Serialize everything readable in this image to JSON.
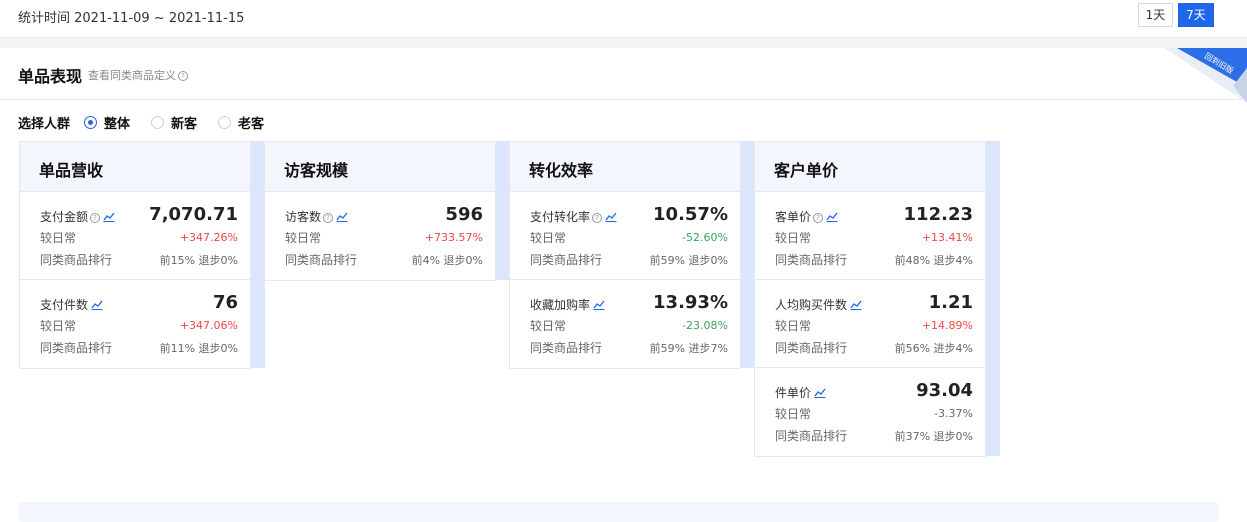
{
  "header": {
    "period_label": "统计时间 2021-11-09 ~ 2021-11-15",
    "range_options": [
      "1天",
      "7天"
    ],
    "active_range": "7天"
  },
  "section": {
    "title": "单品表现",
    "definition_link": "查看同类商品定义",
    "ribbon_text": "回到旧版"
  },
  "audience": {
    "label": "选择人群",
    "options": [
      "整体",
      "新客",
      "老客"
    ],
    "selected": "整体"
  },
  "colors": {
    "accent": "#1f66e8",
    "increase": "#f04646",
    "decrease": "#3aa55a",
    "card_header": "#f3f6fd"
  },
  "cards": [
    {
      "title": "单品营收",
      "metrics": [
        {
          "name": "支付金额",
          "help_icon": true,
          "value": "7,070.71",
          "compare_label": "较日常",
          "change": "+347.26%",
          "direction": "up",
          "rank_label": "同类商品排行",
          "rank": "前15% 退步0%"
        },
        {
          "name": "支付件数",
          "help_icon": false,
          "value": "76",
          "compare_label": "较日常",
          "change": "+347.06%",
          "direction": "up",
          "rank_label": "同类商品排行",
          "rank": "前11% 退步0%"
        }
      ]
    },
    {
      "title": "访客规模",
      "metrics": [
        {
          "name": "访客数",
          "help_icon": true,
          "value": "596",
          "compare_label": "较日常",
          "change": "+733.57%",
          "direction": "up",
          "rank_label": "同类商品排行",
          "rank": "前4% 退步0%"
        }
      ]
    },
    {
      "title": "转化效率",
      "metrics": [
        {
          "name": "支付转化率",
          "help_icon": true,
          "value": "10.57%",
          "compare_label": "较日常",
          "change": "-52.60%",
          "direction": "down",
          "rank_label": "同类商品排行",
          "rank": "前59% 退步0%"
        },
        {
          "name": "收藏加购率",
          "help_icon": false,
          "value": "13.93%",
          "compare_label": "较日常",
          "change": "-23.08%",
          "direction": "down",
          "rank_label": "同类商品排行",
          "rank": "前59% 进步7%"
        }
      ]
    },
    {
      "title": "客户单价",
      "metrics": [
        {
          "name": "客单价",
          "help_icon": true,
          "value": "112.23",
          "compare_label": "较日常",
          "change": "+13.41%",
          "direction": "up",
          "rank_label": "同类商品排行",
          "rank": "前48% 退步4%"
        },
        {
          "name": "人均购买件数",
          "help_icon": false,
          "value": "1.21",
          "compare_label": "较日常",
          "change": "+14.89%",
          "direction": "up",
          "rank_label": "同类商品排行",
          "rank": "前56% 进步4%"
        },
        {
          "name": "件单价",
          "help_icon": false,
          "value": "93.04",
          "compare_label": "较日常",
          "change": "-3.37%",
          "direction": "neutral",
          "rank_label": "同类商品排行",
          "rank": "前37% 退步0%"
        }
      ]
    }
  ]
}
